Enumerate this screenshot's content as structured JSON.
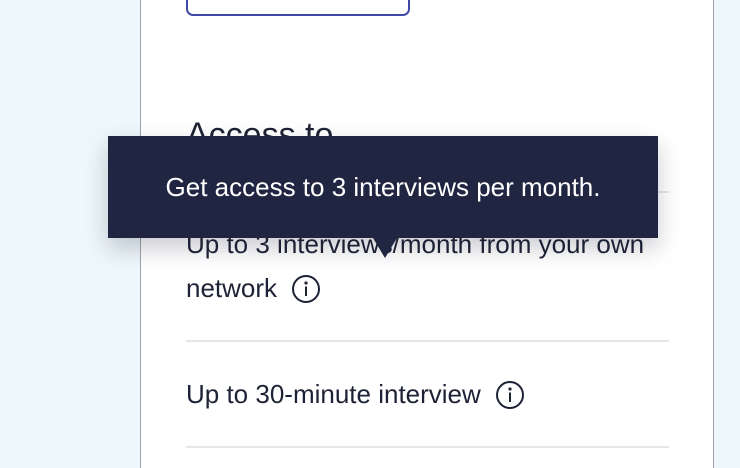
{
  "plan_card": {
    "section_heading": "Access to",
    "features": [
      {
        "label": "Up to 3 interviews/month from your own network",
        "info_icon": "info-icon"
      },
      {
        "label": "Up to 30-minute interview",
        "info_icon": "info-icon"
      }
    ]
  },
  "tooltip": {
    "text": "Get access to 3 interviews per month."
  },
  "colors": {
    "page_background": "#eef7fb",
    "tooltip_background": "#202641",
    "button_border": "#3f4aa8",
    "text": "#1e2235"
  }
}
